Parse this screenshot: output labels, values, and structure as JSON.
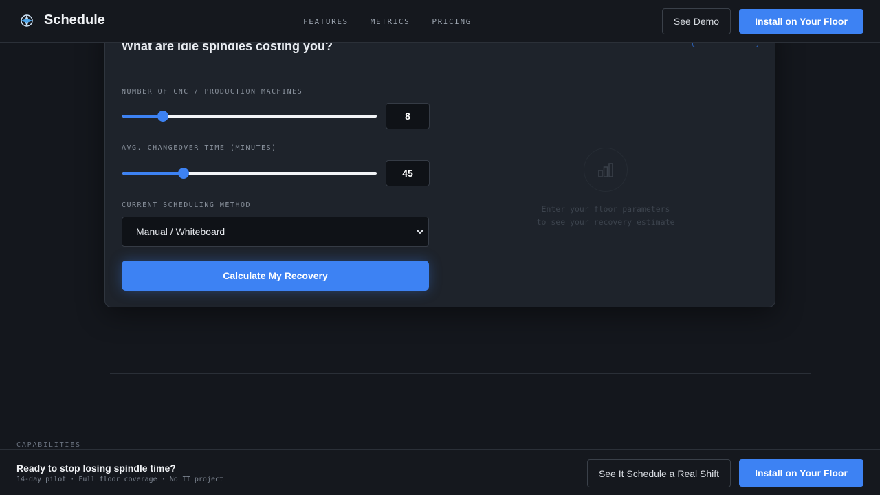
{
  "header": {
    "brand": "Schedule",
    "nav": [
      "FEATURES",
      "METRICS",
      "PRICING"
    ],
    "see_demo": "See Demo",
    "install": "Install on Your Floor"
  },
  "calculator": {
    "title": "What are idle spindles costing you?",
    "machines": {
      "label": "NUMBER OF CNC / PRODUCTION MACHINES",
      "value": "8",
      "fraction": 0.16
    },
    "changeover": {
      "label": "AVG. CHANGEOVER TIME (MINUTES)",
      "value": "45",
      "fraction": 0.24
    },
    "method": {
      "label": "CURRENT SCHEDULING METHOD",
      "selected": "Manual / Whiteboard"
    },
    "calculate": "Calculate My Recovery",
    "placeholder_line1": "Enter your floor parameters",
    "placeholder_line2": "to see your recovery estimate"
  },
  "section": {
    "label": "CAPABILITIES"
  },
  "bottom_bar": {
    "title": "Ready to stop losing spindle time?",
    "subtitle": "14-day pilot · Full floor coverage · No IT project",
    "see_schedule": "See It Schedule a Real Shift",
    "install": "Install on Your Floor"
  },
  "colors": {
    "accent": "#3d82f3",
    "background": "#14171d",
    "card": "#1e232b"
  },
  "icons": {
    "brand": "compass-logo-icon",
    "placeholder": "bar-chart-icon",
    "select": "chevron-down-icon"
  }
}
